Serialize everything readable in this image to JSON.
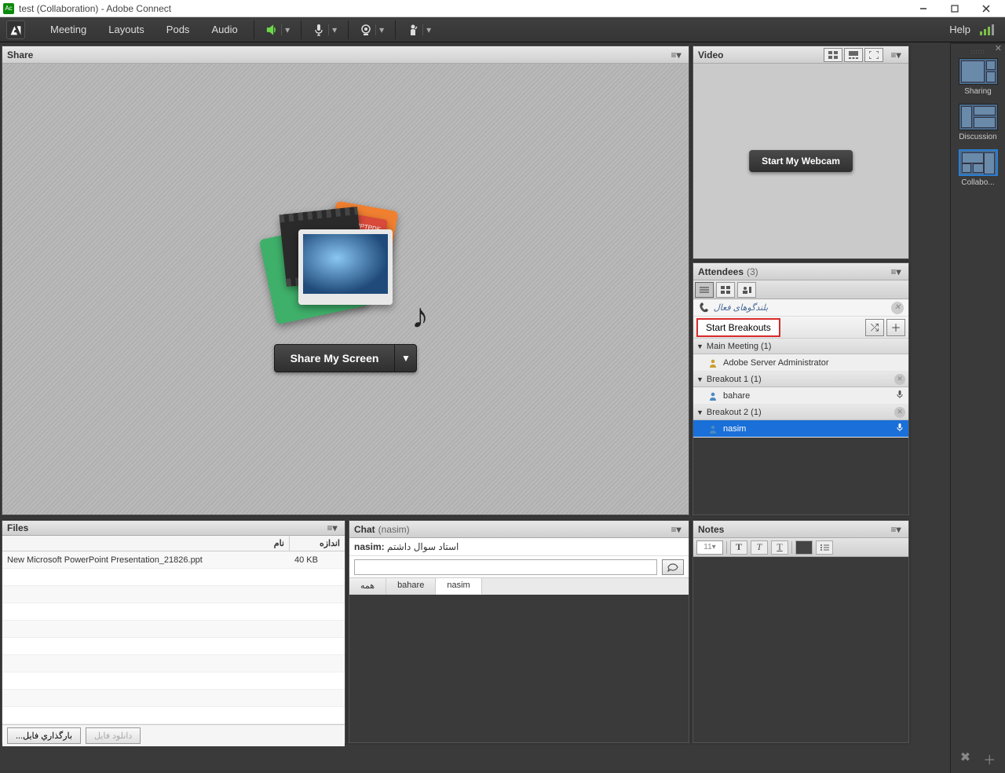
{
  "window": {
    "title": "test (Collaboration) - Adobe Connect"
  },
  "menubar": {
    "adobe_label": "Adobe",
    "items": [
      "Meeting",
      "Layouts",
      "Pods",
      "Audio"
    ]
  },
  "help_label": "Help",
  "layouts_rail": {
    "items": [
      {
        "label": "Sharing"
      },
      {
        "label": "Discussion"
      },
      {
        "label": "Collabo..."
      }
    ],
    "selected_index": 2
  },
  "share_pod": {
    "title": "Share",
    "button_label": "Share My Screen",
    "stack_labels": {
      "ppt": "PPT",
      "pdf": "PDF"
    }
  },
  "video_pod": {
    "title": "Video",
    "button_label": "Start My Webcam"
  },
  "attendees_pod": {
    "title": "Attendees",
    "count_label": "(3)",
    "active_speakers_label": "بلندگوهای فعال",
    "start_breakouts_label": "Start Breakouts",
    "groups": [
      {
        "name": "Main Meeting (1)",
        "closable": false,
        "people": [
          {
            "name": "Adobe Server Administrator",
            "role": "host",
            "mic": false,
            "selected": false
          }
        ]
      },
      {
        "name": "Breakout 1 (1)",
        "closable": true,
        "people": [
          {
            "name": "bahare",
            "role": "participant",
            "mic": true,
            "selected": false
          }
        ]
      },
      {
        "name": "Breakout 2 (1)",
        "closable": true,
        "people": [
          {
            "name": "nasim",
            "role": "participant",
            "mic": true,
            "selected": true
          }
        ]
      }
    ]
  },
  "files_pod": {
    "title": "Files",
    "col_name": "نام",
    "col_size": "اندازه",
    "rows": [
      {
        "name": "New Microsoft PowerPoint Presentation_21826.ppt",
        "size": "40 KB"
      }
    ],
    "upload_label": "بارگذاري فایل...",
    "download_label": "دانلود فایل"
  },
  "chat_pod": {
    "title": "Chat",
    "subtitle": "(nasim)",
    "messages": [
      {
        "author": "nasim:",
        "text": "استاد سوال داشتم"
      }
    ],
    "tabs": [
      "همه",
      "bahare",
      "nasim"
    ],
    "active_tab_index": 2
  },
  "notes_pod": {
    "title": "Notes",
    "font_size": "11"
  }
}
